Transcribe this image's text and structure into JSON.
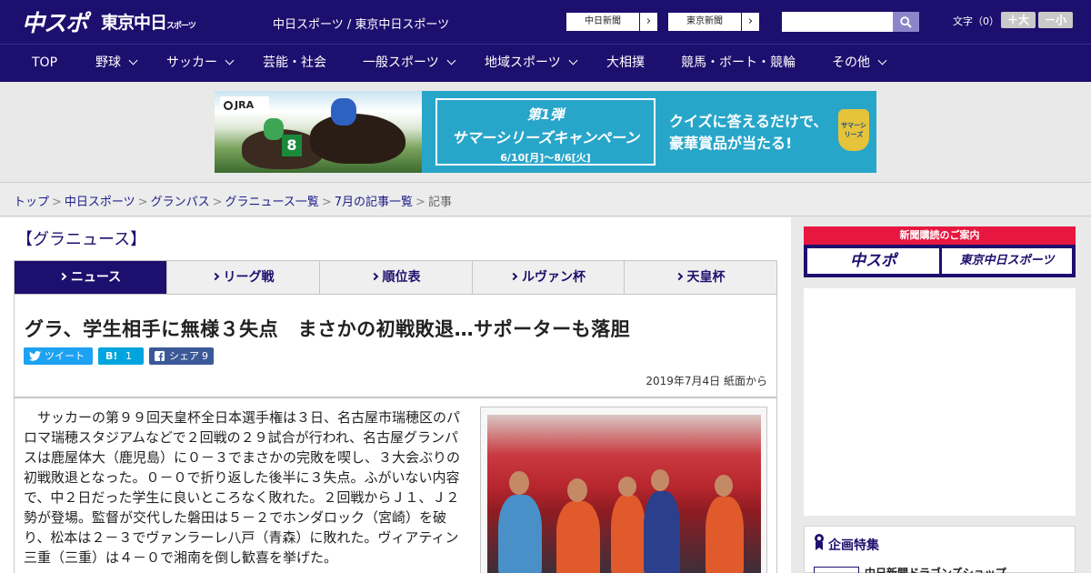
{
  "header": {
    "logo_main": "中スポ",
    "logo_tokyo": "東京中日",
    "logo_tokyo_small": "スポーツ",
    "site_name": "中日スポーツ / 東京中日スポーツ",
    "paper_links": [
      "中日新聞",
      "東京新聞"
    ],
    "search_placeholder": "",
    "text_size_label": "文字（0）",
    "text_larger": "＋大",
    "text_smaller": "－小"
  },
  "nav": {
    "items": [
      {
        "label": "TOP",
        "has_menu": false
      },
      {
        "label": "野球",
        "has_menu": true
      },
      {
        "label": "サッカー",
        "has_menu": true
      },
      {
        "label": "芸能・社会",
        "has_menu": false
      },
      {
        "label": "一般スポーツ",
        "has_menu": true
      },
      {
        "label": "地域スポーツ",
        "has_menu": true
      },
      {
        "label": "大相撲",
        "has_menu": false
      },
      {
        "label": "競馬・ボート・競輪",
        "has_menu": false
      },
      {
        "label": "その他",
        "has_menu": true
      }
    ]
  },
  "ad_banner": {
    "brand": "JRA",
    "saddle_number": "8",
    "campaign_no": "第1弾",
    "campaign_title": "サマーシリーズキャンペーン",
    "campaign_dates": "6/10[月]～8/6[火]",
    "quiz_line1": "クイズに答えるだけで、",
    "quiz_line2": "豪華賞品が当たる!",
    "trophy_text": "サマーシリーズ"
  },
  "breadcrumb": {
    "links": [
      "トップ",
      "中日スポーツ",
      "グランパス",
      "グラニュース一覧",
      "7月の記事一覧"
    ],
    "current": "記事",
    "separator": ">"
  },
  "section": {
    "title": "【グラニュース】"
  },
  "tabs": [
    {
      "label": "ニュース",
      "active": true
    },
    {
      "label": "リーグ戦",
      "active": false
    },
    {
      "label": "順位表",
      "active": false
    },
    {
      "label": "ルヴァン杯",
      "active": false
    },
    {
      "label": "天皇杯",
      "active": false
    }
  ],
  "article": {
    "headline": "グラ、学生相手に無様３失点　まさかの初戦敗退…サポーターも落胆",
    "share": {
      "tweet": "ツイート",
      "hatena": "B!",
      "hatena_count": "1",
      "facebook": "シェア",
      "facebook_count": "9"
    },
    "dateline": "2019年7月4日 紙面から",
    "body": "　サッカーの第９９回天皇杯全日本選手権は３日、名古屋市瑞穂区のパロマ瑞穂スタジアムなどで２回戦の２９試合が行われ、名古屋グランパスは鹿屋体大（鹿児島）に０－３でまさかの完敗を喫し、３大会ぶりの初戦敗退となった。０－０で折り返した後半に３失点。ふがいない内容で、中２日だった学生に良いところなく敗れた。２回戦からＪ１、Ｊ２勢が登場。監督が交代した磐田は５－２でホンダロック（宮崎）を破り、松本は２－３でヴァンラーレ八戸（青森）に敗れた。ヴィアティン三重（三重）は４－０で湘南を倒し歓喜を挙げた。"
  },
  "sidebar": {
    "promo_header": "新聞購読のご案内",
    "promo_buttons": [
      "中スポ",
      "東京中日スポーツ"
    ],
    "feature_title": "企画特集",
    "feature_item": "中日新聞ドラゴンズショップ"
  },
  "colors": {
    "brand_navy": "#1d0f6e",
    "accent_red": "#e8173f",
    "twitter_blue": "#1da1f2",
    "hatena_blue": "#00a4de",
    "facebook_blue": "#3b5998"
  }
}
